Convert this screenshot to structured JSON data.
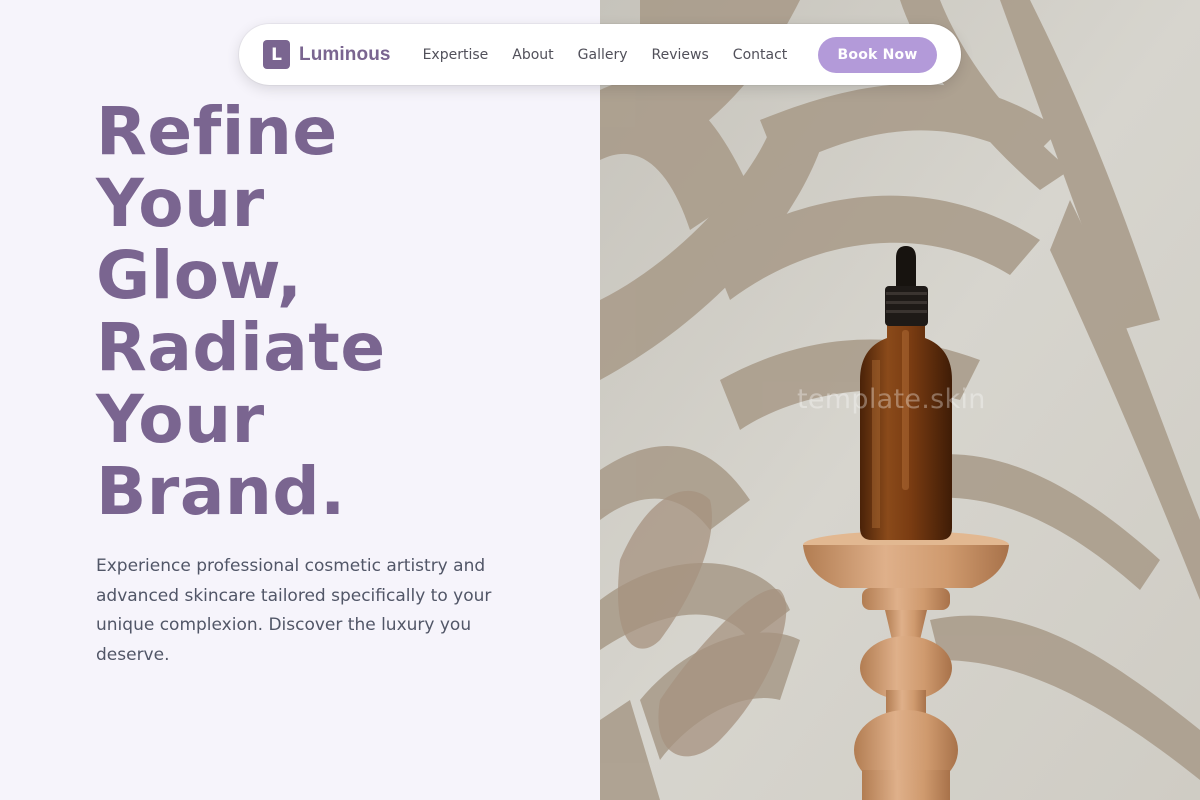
{
  "brand": {
    "logo_letter": "L",
    "name": "Luminous"
  },
  "nav": {
    "links": [
      "Expertise",
      "About",
      "Gallery",
      "Reviews",
      "Contact"
    ],
    "cta_label": "Book Now"
  },
  "hero": {
    "title_lines": [
      "Refine",
      "Your",
      "Glow,",
      "Radiate",
      "Your",
      "Brand."
    ],
    "subtitle": "Experience professional cosmetic artistry and advanced skincare tailored specifically to your unique complexion. Discover the luxury you deserve."
  },
  "image": {
    "watermark": "template.skin"
  },
  "colors": {
    "accent": "#7a6590",
    "cta": "#b39ad9",
    "left_background": "#f6f4fb",
    "body_text": "#515667"
  }
}
